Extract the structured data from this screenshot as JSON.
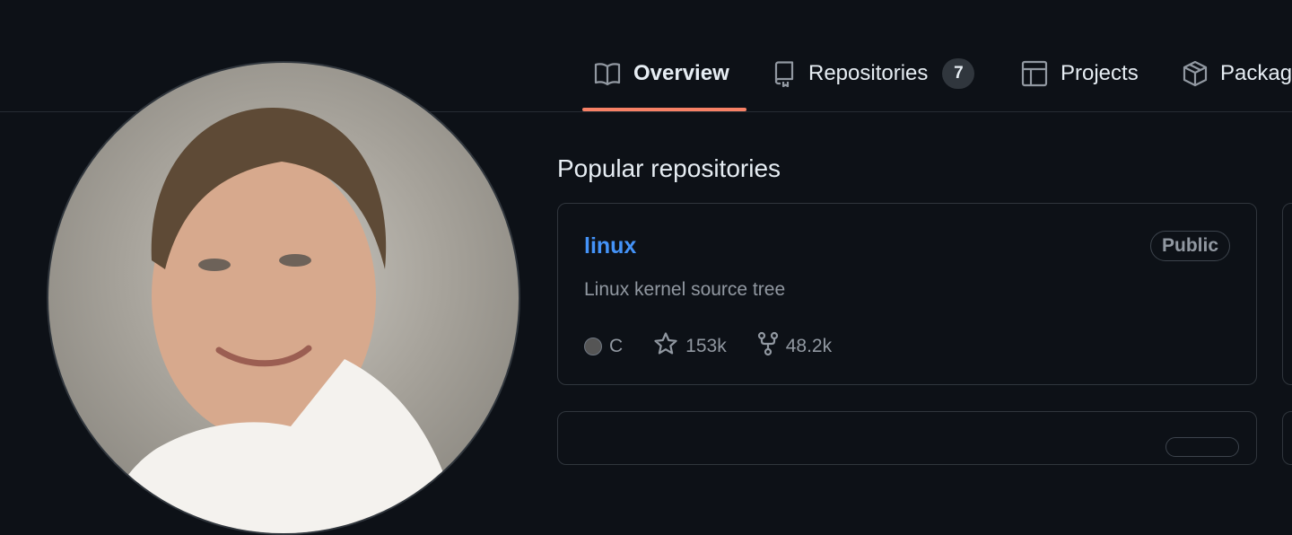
{
  "tabs": [
    {
      "label": "Overview",
      "icon": "book-icon",
      "selected": true
    },
    {
      "label": "Repositories",
      "icon": "repo-icon",
      "count": "7"
    },
    {
      "label": "Projects",
      "icon": "table-icon"
    },
    {
      "label": "Packag",
      "icon": "package-icon"
    }
  ],
  "colors": {
    "background": "#0d1117",
    "accent_underline": "#f78166",
    "link": "#4493f8",
    "muted": "#9198a1",
    "border": "#30363d"
  },
  "profile": {
    "avatar_icon": "avatar-photo"
  },
  "popular": {
    "title": "Popular repositories",
    "repos": [
      {
        "name": "linux",
        "visibility": "Public",
        "description": "Linux kernel source tree",
        "language": "C",
        "stars": "153k",
        "forks": "48.2k"
      }
    ]
  }
}
